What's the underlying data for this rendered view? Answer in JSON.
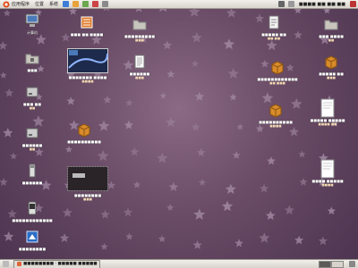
{
  "top_panel": {
    "menus": [
      {
        "name": "menu-applications",
        "label": "应用程序"
      },
      {
        "name": "menu-places",
        "label": "位置"
      },
      {
        "name": "menu-system",
        "label": "系统"
      }
    ],
    "clock": "■■■■ ■■ ■■:■■"
  },
  "desktop": {
    "icons": [
      {
        "name": "computer-icon-item",
        "glyph": "computer",
        "label": "计算机"
      },
      {
        "name": "bamboo-icon-item",
        "glyph": "orange-box",
        "label": "■■■ ■■ ■■■■"
      },
      {
        "name": "folder-icon-item-1",
        "glyph": "folder-gray",
        "label": "■■■■■■■■■",
        "sub": "■■■"
      },
      {
        "name": "document-icon-item-1",
        "glyph": "document",
        "label": "■■■■■ ■■",
        "sub": "■■ ■■"
      },
      {
        "name": "folder-icon-item-2",
        "glyph": "folder-gray",
        "label": "■■■ ■■■■",
        "sub": "■■"
      },
      {
        "name": "home-folder-icon-item",
        "glyph": "folder-gray",
        "label": "■■■"
      },
      {
        "name": "screenshot-image-item",
        "glyph": "screenshot",
        "label": "■■■■■■■ ■■■■",
        "sub": "■■■■"
      },
      {
        "name": "text-file-icon-item",
        "glyph": "text-file",
        "label": "■■■■■■",
        "sub": "■■■"
      },
      {
        "name": "package-icon-item-1",
        "glyph": "package",
        "label": "■■■■■■■■■■■■",
        "sub": "■■ ■■■"
      },
      {
        "name": "package-icon-item-2",
        "glyph": "package",
        "label": "■■■■■ ■■",
        "sub": "■■■"
      },
      {
        "name": "drive-icon-item-1",
        "glyph": "drive",
        "label": "■■■ ■■",
        "sub": "■■"
      },
      {
        "name": "package-icon-item-3",
        "glyph": "package",
        "label": "■■■■■■■■■■",
        "sub": "■■■■"
      },
      {
        "name": "pdf-icon-item-1",
        "glyph": "paper",
        "label": "■■■■■ ■■■■■",
        "sub": "■■■■ ■■"
      },
      {
        "name": "drive-icon-item-2",
        "glyph": "drive",
        "label": "■■■■■■",
        "sub": "■■"
      },
      {
        "name": "package-icon-item-4",
        "glyph": "package",
        "label": "■■■■■■■■■■"
      },
      {
        "name": "usb-drive-icon-item",
        "glyph": "usb",
        "label": "■■■■■■"
      },
      {
        "name": "dark-image-item",
        "glyph": "dark-image",
        "label": "■■■■■■■■",
        "sub": "■■■"
      },
      {
        "name": "pdf-icon-item-2",
        "glyph": "paper",
        "label": "■■■■ ■■■■■",
        "sub": "■■■■"
      },
      {
        "name": "phone-icon-item",
        "glyph": "phone",
        "label": "■■■■■■■■■■■■"
      },
      {
        "name": "blue-app-icon-item",
        "glyph": "blue-app",
        "label": "■■■■■■■■"
      }
    ]
  },
  "bottom_panel": {
    "taskbar_window_label": "■■■■■■■■ - ■■■■■ ■■■■■"
  },
  "colors": {
    "desktop_top": "#8a6a84",
    "desktop_bottom": "#4d3450",
    "star": "#9f85a0",
    "package_orange": "#d98b2a",
    "folder_gray": "#c8c5bd",
    "blue_app": "#2a6cc4"
  }
}
